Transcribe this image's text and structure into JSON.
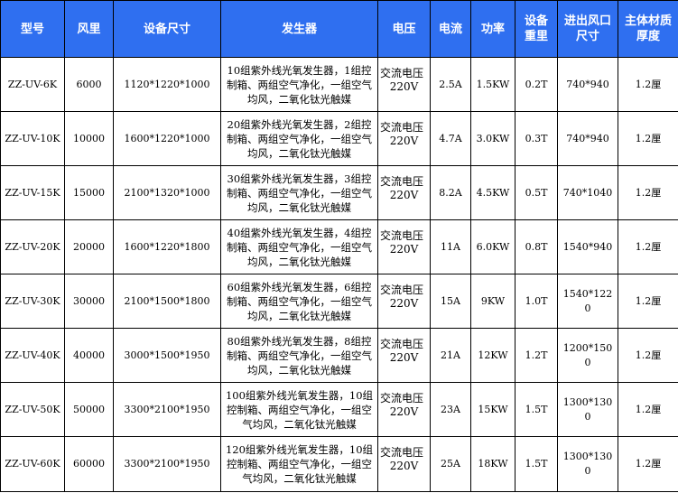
{
  "table": {
    "headers": [
      {
        "lines": [
          "型号"
        ]
      },
      {
        "lines": [
          "风里"
        ]
      },
      {
        "lines": [
          "设备尺寸"
        ]
      },
      {
        "lines": [
          "发生器"
        ]
      },
      {
        "lines": [
          "电压"
        ]
      },
      {
        "lines": [
          "电流"
        ]
      },
      {
        "lines": [
          "功率"
        ]
      },
      {
        "lines": [
          "设备",
          "重里"
        ]
      },
      {
        "lines": [
          "进出风口",
          "尺寸"
        ]
      },
      {
        "lines": [
          "主体材质",
          "厚度"
        ]
      }
    ],
    "rows": [
      {
        "model": "ZZ-UV-6K",
        "airflow": "6000",
        "size": "1120*1220*1000",
        "generator": "10组紫外线光氧发生器，1组控制箱、两组空气净化，一组空气均风，二氧化钛光触媒",
        "voltage": "交流电压",
        "voltage_value": "220V",
        "current": "2.5A",
        "power": "1.5KW",
        "weight": "0.2T",
        "opening": "740*940",
        "thickness": "1.2厘"
      },
      {
        "model": "ZZ-UV-10K",
        "airflow": "10000",
        "size": "1600*1220*1000",
        "generator": "20组紫外线光氧发生器，2组控制箱、两组空气净化，一组空气均风，二氧化钛光触媒",
        "voltage": "交流电压",
        "voltage_value": "220V",
        "current": "4.7A",
        "power": "3.0KW",
        "weight": "0.3T",
        "opening": "740*940",
        "thickness": "1.2厘"
      },
      {
        "model": "ZZ-UV-15K",
        "airflow": "15000",
        "size": "2100*1320*1000",
        "generator": "30组紫外线光氧发生器，3组控制箱、两组空气净化，一组空气均风，二氧化钛光触媒",
        "voltage": "交流电压",
        "voltage_value": "220V",
        "current": "8.2A",
        "power": "4.5KW",
        "weight": "0.5T",
        "opening": "740*1040",
        "thickness": "1.2厘"
      },
      {
        "model": "ZZ-UV-20K",
        "airflow": "20000",
        "size": "1600*1220*1800",
        "generator": "40组紫外线光氧发生器，4组控制箱、两组空气净化，一组空气均风，二氧化钛光触媒",
        "voltage": "交流电压",
        "voltage_value": "220V",
        "current": "11A",
        "power": "6.0KW",
        "weight": "0.8T",
        "opening": "1540*940",
        "thickness": "1.2厘"
      },
      {
        "model": "ZZ-UV-30K",
        "airflow": "30000",
        "size": "2100*1500*1800",
        "generator": "60组紫外线光氧发生器，6组控制箱、两组空气净化，一组空气均风，二氧化钛光触媒",
        "voltage": "交流电压",
        "voltage_value": "220V",
        "current": "15A",
        "power": "9KW",
        "weight": "1.0T",
        "opening": "1540*1220",
        "thickness": "1.2厘"
      },
      {
        "model": "ZZ-UV-40K",
        "airflow": "40000",
        "size": "3000*1500*1950",
        "generator": "80组紫外线光氧发生器，8组控制箱、两组空气净化，一组空气均风，二氧化钛光触媒",
        "voltage": "交流电压",
        "voltage_value": "220V",
        "current": "21A",
        "power": "12KW",
        "weight": "1.2T",
        "opening": "1200*1500",
        "thickness": "1.2厘"
      },
      {
        "model": "ZZ-UV-50K",
        "airflow": "50000",
        "size": "3300*2100*1950",
        "generator": "100组紫外线光氧发生器，10组控制箱、两组空气净化，一组空气均风，二氧化钛光触媒",
        "voltage": "交流电压",
        "voltage_value": "220V",
        "current": "23A",
        "power": "15KW",
        "weight": "1.5T",
        "opening": "1300*1300",
        "thickness": "1.2厘"
      },
      {
        "model": "ZZ-UV-60K",
        "airflow": "60000",
        "size": "3300*2100*1950",
        "generator": "120组紫外线光氧发生器，10组控制箱、两组空气净化，一组空气均风，二氧化钛光触媒",
        "voltage": "交流电压",
        "voltage_value": "220V",
        "current": "25A",
        "power": "18KW",
        "weight": "1.5T",
        "opening": "1300*1300",
        "thickness": "1.2厘"
      }
    ]
  },
  "colors": {
    "header_bg": "#2f6ff0",
    "header_text": "#ffffff",
    "border": "#000000",
    "body_bg": "#ffffff"
  }
}
